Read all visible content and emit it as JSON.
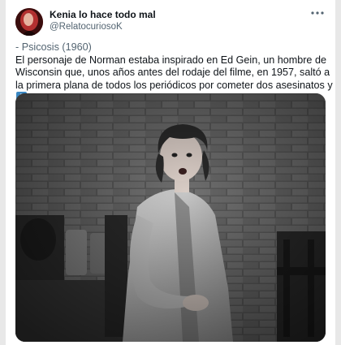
{
  "tweet": {
    "author_name": "Kenia lo hace todo mal",
    "author_handle": "@RelatocuriosoK",
    "text_line1": "- Psicosis (1960)",
    "text_body": "El personaje de Norman estaba inspirado en Ed Gein, un hombre de Wisconsin que, unos años antes del rodaje del filme, en 1957, saltó a la primera plana de todos los periódicos por cometer dos asesinatos y",
    "trailing_emoji": "down-arrow-emoji",
    "media_type": "photo"
  },
  "icons": {
    "more": "more-options-icon",
    "emoji": "down-arrow-emoji"
  },
  "colors": {
    "name": "#0f1419",
    "secondary": "#536471",
    "emoji_blue": "#3b88c3"
  }
}
